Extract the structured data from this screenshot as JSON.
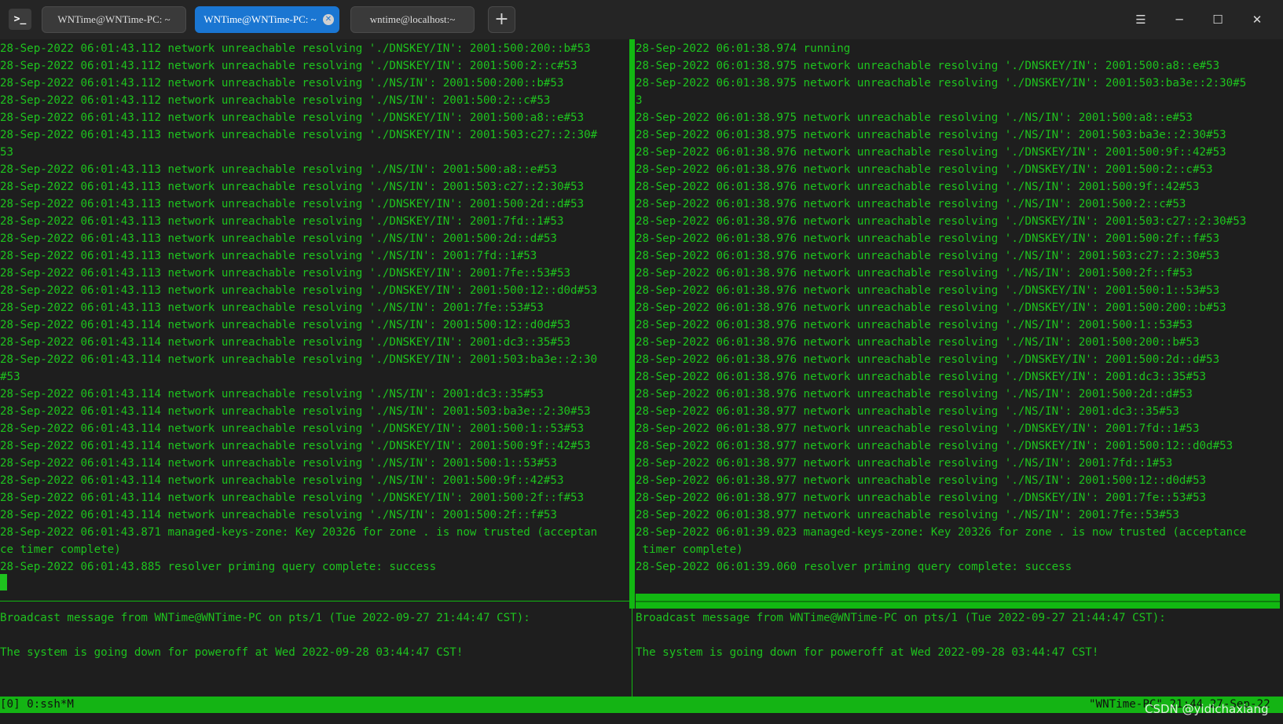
{
  "window": {
    "tabs": [
      {
        "title": "WNTime@WNTime-PC: ~"
      },
      {
        "title": "WNTime@WNTime-PC: ~"
      },
      {
        "title": "wntime@localhost:~"
      }
    ],
    "active_tab_index": 1,
    "accent_color": "#1a76d2"
  },
  "terminal": {
    "text_color": "#1ec31e",
    "left_pane": {
      "lines": [
        "28-Sep-2022 06:01:43.112 network unreachable resolving './DNSKEY/IN': 2001:500:200::b#53",
        "28-Sep-2022 06:01:43.112 network unreachable resolving './DNSKEY/IN': 2001:500:2::c#53",
        "28-Sep-2022 06:01:43.112 network unreachable resolving './NS/IN': 2001:500:200::b#53",
        "28-Sep-2022 06:01:43.112 network unreachable resolving './NS/IN': 2001:500:2::c#53",
        "28-Sep-2022 06:01:43.112 network unreachable resolving './DNSKEY/IN': 2001:500:a8::e#53",
        "28-Sep-2022 06:01:43.113 network unreachable resolving './DNSKEY/IN': 2001:503:c27::2:30#",
        "53",
        "28-Sep-2022 06:01:43.113 network unreachable resolving './NS/IN': 2001:500:a8::e#53",
        "28-Sep-2022 06:01:43.113 network unreachable resolving './NS/IN': 2001:503:c27::2:30#53",
        "28-Sep-2022 06:01:43.113 network unreachable resolving './DNSKEY/IN': 2001:500:2d::d#53",
        "28-Sep-2022 06:01:43.113 network unreachable resolving './DNSKEY/IN': 2001:7fd::1#53",
        "28-Sep-2022 06:01:43.113 network unreachable resolving './NS/IN': 2001:500:2d::d#53",
        "28-Sep-2022 06:01:43.113 network unreachable resolving './NS/IN': 2001:7fd::1#53",
        "28-Sep-2022 06:01:43.113 network unreachable resolving './DNSKEY/IN': 2001:7fe::53#53",
        "28-Sep-2022 06:01:43.113 network unreachable resolving './DNSKEY/IN': 2001:500:12::d0d#53",
        "28-Sep-2022 06:01:43.113 network unreachable resolving './NS/IN': 2001:7fe::53#53",
        "28-Sep-2022 06:01:43.114 network unreachable resolving './NS/IN': 2001:500:12::d0d#53",
        "28-Sep-2022 06:01:43.114 network unreachable resolving './DNSKEY/IN': 2001:dc3::35#53",
        "28-Sep-2022 06:01:43.114 network unreachable resolving './DNSKEY/IN': 2001:503:ba3e::2:30",
        "#53",
        "28-Sep-2022 06:01:43.114 network unreachable resolving './NS/IN': 2001:dc3::35#53",
        "28-Sep-2022 06:01:43.114 network unreachable resolving './NS/IN': 2001:503:ba3e::2:30#53",
        "28-Sep-2022 06:01:43.114 network unreachable resolving './DNSKEY/IN': 2001:500:1::53#53",
        "28-Sep-2022 06:01:43.114 network unreachable resolving './DNSKEY/IN': 2001:500:9f::42#53",
        "28-Sep-2022 06:01:43.114 network unreachable resolving './NS/IN': 2001:500:1::53#53",
        "28-Sep-2022 06:01:43.114 network unreachable resolving './NS/IN': 2001:500:9f::42#53",
        "28-Sep-2022 06:01:43.114 network unreachable resolving './DNSKEY/IN': 2001:500:2f::f#53",
        "28-Sep-2022 06:01:43.114 network unreachable resolving './NS/IN': 2001:500:2f::f#53",
        "28-Sep-2022 06:01:43.871 managed-keys-zone: Key 20326 for zone . is now trusted (acceptan",
        "ce timer complete)",
        "28-Sep-2022 06:01:43.885 resolver priming query complete: success"
      ]
    },
    "right_pane": {
      "lines": [
        "28-Sep-2022 06:01:38.974 running",
        "28-Sep-2022 06:01:38.975 network unreachable resolving './DNSKEY/IN': 2001:500:a8::e#53",
        "28-Sep-2022 06:01:38.975 network unreachable resolving './DNSKEY/IN': 2001:503:ba3e::2:30#5",
        "3",
        "28-Sep-2022 06:01:38.975 network unreachable resolving './NS/IN': 2001:500:a8::e#53",
        "28-Sep-2022 06:01:38.975 network unreachable resolving './NS/IN': 2001:503:ba3e::2:30#53",
        "28-Sep-2022 06:01:38.976 network unreachable resolving './DNSKEY/IN': 2001:500:9f::42#53",
        "28-Sep-2022 06:01:38.976 network unreachable resolving './DNSKEY/IN': 2001:500:2::c#53",
        "28-Sep-2022 06:01:38.976 network unreachable resolving './NS/IN': 2001:500:9f::42#53",
        "28-Sep-2022 06:01:38.976 network unreachable resolving './NS/IN': 2001:500:2::c#53",
        "28-Sep-2022 06:01:38.976 network unreachable resolving './DNSKEY/IN': 2001:503:c27::2:30#53",
        "28-Sep-2022 06:01:38.976 network unreachable resolving './DNSKEY/IN': 2001:500:2f::f#53",
        "28-Sep-2022 06:01:38.976 network unreachable resolving './NS/IN': 2001:503:c27::2:30#53",
        "28-Sep-2022 06:01:38.976 network unreachable resolving './NS/IN': 2001:500:2f::f#53",
        "28-Sep-2022 06:01:38.976 network unreachable resolving './DNSKEY/IN': 2001:500:1::53#53",
        "28-Sep-2022 06:01:38.976 network unreachable resolving './DNSKEY/IN': 2001:500:200::b#53",
        "28-Sep-2022 06:01:38.976 network unreachable resolving './NS/IN': 2001:500:1::53#53",
        "28-Sep-2022 06:01:38.976 network unreachable resolving './NS/IN': 2001:500:200::b#53",
        "28-Sep-2022 06:01:38.976 network unreachable resolving './DNSKEY/IN': 2001:500:2d::d#53",
        "28-Sep-2022 06:01:38.976 network unreachable resolving './DNSKEY/IN': 2001:dc3::35#53",
        "28-Sep-2022 06:01:38.976 network unreachable resolving './NS/IN': 2001:500:2d::d#53",
        "28-Sep-2022 06:01:38.977 network unreachable resolving './NS/IN': 2001:dc3::35#53",
        "28-Sep-2022 06:01:38.977 network unreachable resolving './DNSKEY/IN': 2001:7fd::1#53",
        "28-Sep-2022 06:01:38.977 network unreachable resolving './DNSKEY/IN': 2001:500:12::d0d#53",
        "28-Sep-2022 06:01:38.977 network unreachable resolving './NS/IN': 2001:7fd::1#53",
        "28-Sep-2022 06:01:38.977 network unreachable resolving './NS/IN': 2001:500:12::d0d#53",
        "28-Sep-2022 06:01:38.977 network unreachable resolving './DNSKEY/IN': 2001:7fe::53#53",
        "28-Sep-2022 06:01:38.977 network unreachable resolving './NS/IN': 2001:7fe::53#53",
        "28-Sep-2022 06:01:39.023 managed-keys-zone: Key 20326 for zone . is now trusted (acceptance",
        " timer complete)",
        "28-Sep-2022 06:01:39.060 resolver priming query complete: success"
      ]
    },
    "broadcast": {
      "lines": [
        "Broadcast message from WNTime@WNTime-PC on pts/1 (Tue 2022-09-27 21:44:47 CST):",
        "",
        "The system is going down for poweroff at Wed 2022-09-28 03:44:47 CST!"
      ]
    },
    "status_bar": {
      "left": "[0] 0:ssh*M",
      "right": "\"WNTime-PC\" 21:44 27-Sep-22",
      "background_color": "#14b414"
    }
  },
  "watermark": "CSDN @yidichaxiang"
}
